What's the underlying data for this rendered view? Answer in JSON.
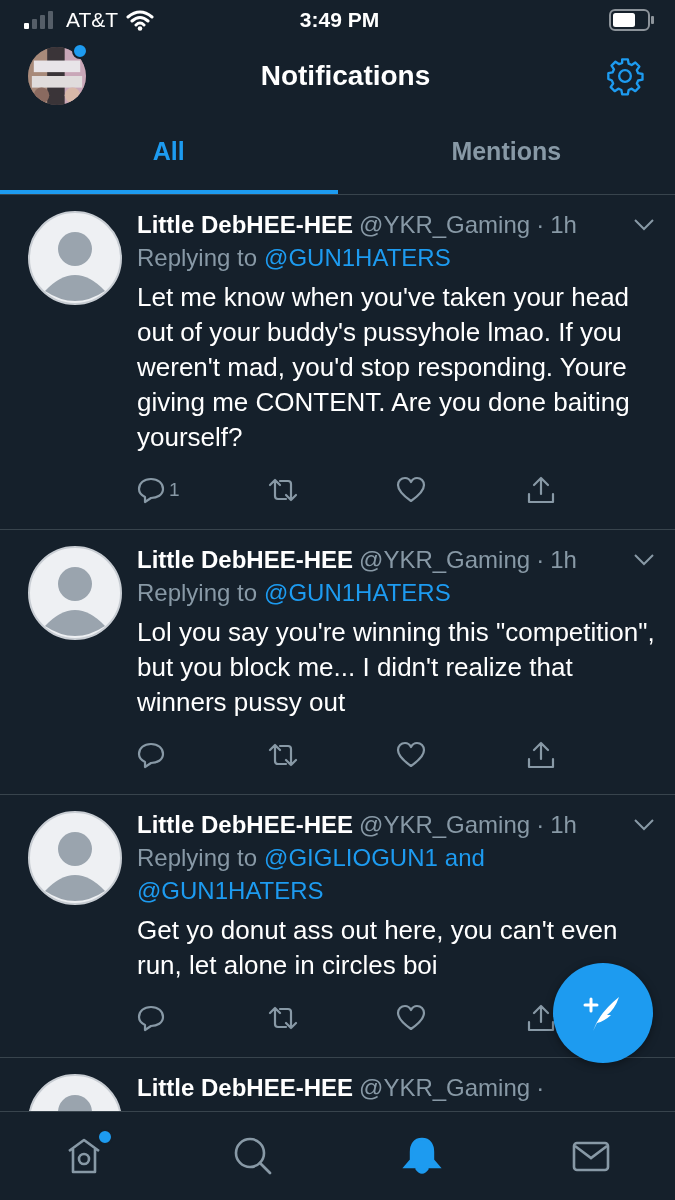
{
  "status_bar": {
    "carrier": "AT&T",
    "time": "3:49 PM"
  },
  "header": {
    "title": "Notifications",
    "avatar_badge": true
  },
  "tabs": [
    {
      "label": "All",
      "selected": true
    },
    {
      "label": "Mentions",
      "selected": false
    }
  ],
  "tweets": [
    {
      "name": "Little DebHEE-HEE",
      "handle": "@YKR_Gaming",
      "sep": "·",
      "time": "1h",
      "reply": {
        "label": "Replying to",
        "mentions": [
          "@GUN1HATERS"
        ]
      },
      "text": "Let me know when you've taken your head out of your buddy's pussyhole lmao. If you weren't mad, you'd stop responding. Youre giving me CONTENT. Are you done baiting yourself?",
      "reply_count": "1"
    },
    {
      "name": "Little DebHEE-HEE",
      "handle": "@YKR_Gaming",
      "sep": "·",
      "time": "1h",
      "reply": {
        "label": "Replying to",
        "mentions": [
          "@GUN1HATERS"
        ]
      },
      "text": "Lol you say you're winning this \"competition\", but you block me... I didn't realize that winners pussy out"
    },
    {
      "name": "Little DebHEE-HEE",
      "handle": "@YKR_Gaming",
      "sep": "·",
      "time": "1h",
      "reply": {
        "label": "Replying to",
        "mentions": [
          "@GIGLIOGUN1",
          "@GUN1HATERS"
        ],
        "joiner": "and"
      },
      "text": "Get yo donut ass out here, you can't even run, let alone in circles boi"
    },
    {
      "name": "Little DebHEE-HEE",
      "handle": "@YKR_Gaming",
      "sep": "·"
    }
  ],
  "bottom_nav": [
    {
      "kind": "home",
      "selected": false,
      "badge": true
    },
    {
      "kind": "search",
      "selected": false,
      "badge": false
    },
    {
      "kind": "notifications",
      "selected": true,
      "badge": false
    },
    {
      "kind": "messages",
      "selected": false,
      "badge": false
    }
  ]
}
